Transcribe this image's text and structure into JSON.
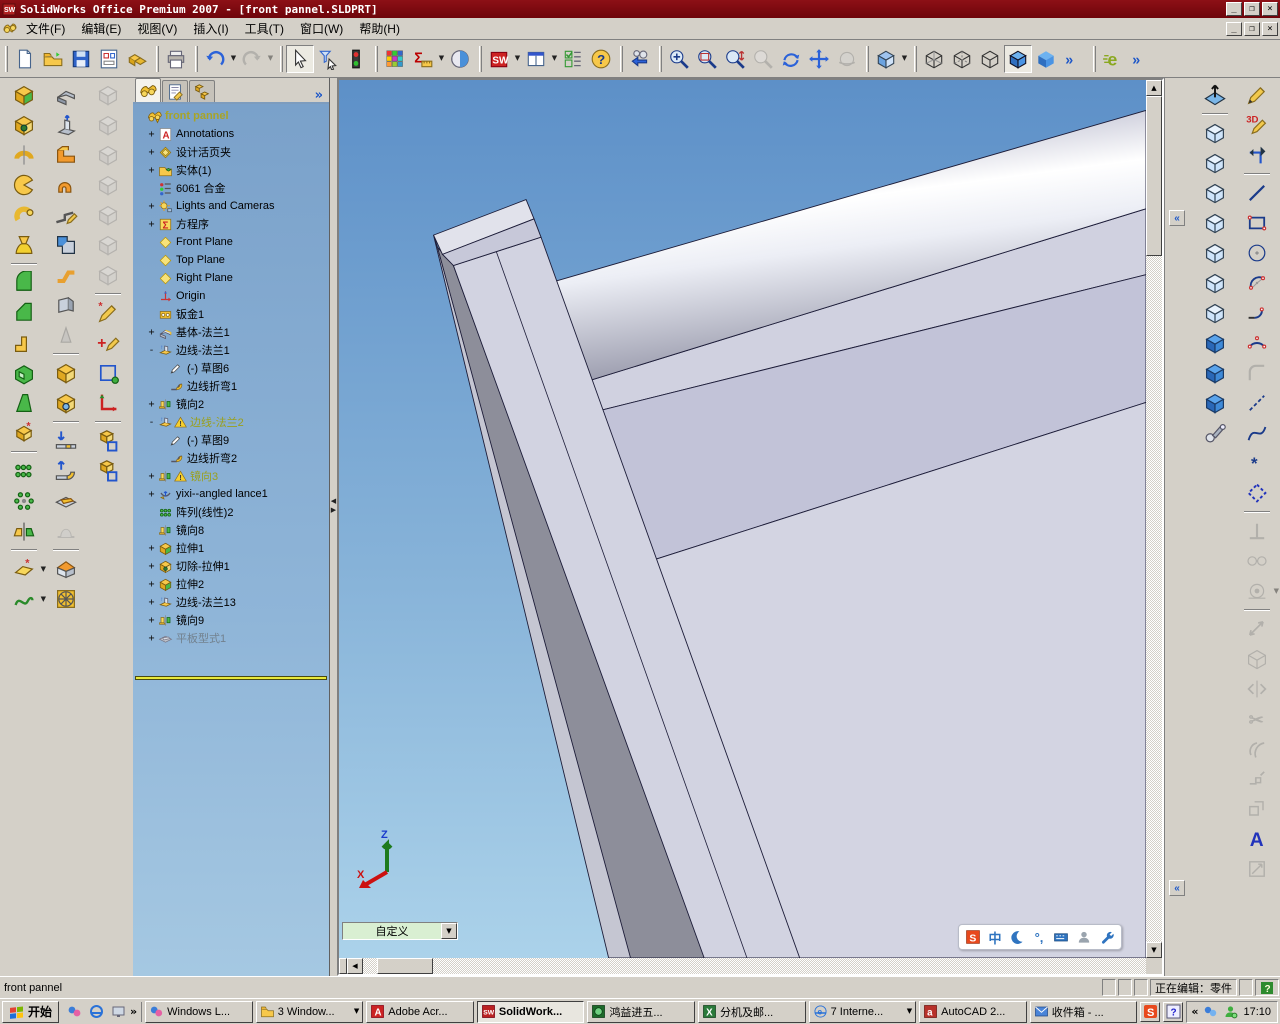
{
  "window": {
    "title": "SolidWorks Office Premium 2007 - [front pannel.SLDPRT]",
    "app_icon": "solidworks-logo",
    "controls": [
      "minimize",
      "restore",
      "close"
    ]
  },
  "menubar": {
    "doc_icon": "solidworks-doc",
    "items": [
      "文件(F)",
      "编辑(E)",
      "视图(V)",
      "插入(I)",
      "工具(T)",
      "窗口(W)",
      "帮助(H)"
    ]
  },
  "toolbar": {
    "groups": [
      [
        {
          "icon": "new-doc",
          "name": "new-document"
        },
        {
          "icon": "open-folder",
          "name": "open"
        },
        {
          "icon": "save",
          "name": "save"
        },
        {
          "icon": "make-drawing",
          "name": "make-drawing-from-part"
        },
        {
          "icon": "make-assembly",
          "name": "make-assembly-from-part"
        }
      ],
      [
        {
          "icon": "print",
          "name": "print"
        }
      ],
      [
        {
          "icon": "undo",
          "name": "undo",
          "dd": true
        },
        {
          "icon": "redo",
          "name": "redo",
          "dd": true,
          "dis": true
        }
      ],
      [
        {
          "icon": "select",
          "name": "select",
          "pressed": true
        },
        {
          "icon": "filter",
          "name": "selection-filter"
        },
        {
          "icon": "traffic",
          "name": "stoplight-rebuild"
        }
      ],
      [
        {
          "icon": "palette",
          "name": "color-swatches"
        },
        {
          "icon": "measure",
          "name": "measure",
          "dd": true
        },
        {
          "icon": "appearance",
          "name": "appearance"
        }
      ],
      [
        {
          "icon": "sw-central",
          "name": "3d-content-central",
          "dd": true
        },
        {
          "icon": "split-view",
          "name": "split-window",
          "dd": true
        },
        {
          "icon": "options-list",
          "name": "options"
        },
        {
          "icon": "help",
          "name": "help"
        }
      ],
      [
        {
          "icon": "view-prev",
          "name": "previous-view"
        }
      ],
      [
        {
          "icon": "zoom-fit",
          "name": "zoom-to-fit"
        },
        {
          "icon": "zoom-area",
          "name": "zoom-to-area"
        },
        {
          "icon": "zoom-inout",
          "name": "zoom-in-out"
        },
        {
          "icon": "zoom-select",
          "name": "zoom-to-selection",
          "dis": true
        },
        {
          "icon": "rotate-view",
          "name": "rotate-view"
        },
        {
          "icon": "pan",
          "name": "pan"
        },
        {
          "icon": "rotate-3d",
          "name": "rotate-about-axis",
          "dis": true
        }
      ],
      [
        {
          "icon": "std-views",
          "name": "standard-views",
          "dd": true
        }
      ],
      [
        {
          "icon": "cube-wire",
          "name": "wireframe"
        },
        {
          "icon": "cube-hlv",
          "name": "hidden-lines-visible"
        },
        {
          "icon": "cube-hlr",
          "name": "hidden-lines-removed"
        },
        {
          "icon": "cube-shaded-edges",
          "name": "shaded-with-edges",
          "pressed": true
        },
        {
          "icon": "cube-shaded",
          "name": "shaded"
        },
        {
          "icon": "chevrons",
          "name": "toolbar-overflow"
        }
      ],
      [
        {
          "icon": "edrawings",
          "name": "edrawings"
        },
        {
          "icon": "chevrons",
          "name": "toolbar-overflow-2"
        }
      ]
    ]
  },
  "left_dock": {
    "columns": [
      [
        {
          "icon": "extrude",
          "name": "extruded-boss"
        },
        {
          "icon": "cut-extrude",
          "name": "extruded-cut"
        },
        {
          "icon": "revolve",
          "name": "revolved-boss"
        },
        {
          "icon": "cut-revolve",
          "name": "revolved-cut"
        },
        {
          "icon": "sweep",
          "name": "swept-boss"
        },
        {
          "icon": "loft",
          "name": "lofted-boss"
        },
        "-",
        {
          "icon": "fillet",
          "name": "fillet"
        },
        {
          "icon": "chamfer",
          "name": "chamfer"
        },
        {
          "icon": "rib",
          "name": "rib"
        },
        {
          "icon": "shell",
          "name": "shell"
        },
        {
          "icon": "draft",
          "name": "draft"
        },
        {
          "icon": "hole-wizard",
          "name": "hole-wizard"
        },
        "-",
        {
          "icon": "lin-pattern",
          "name": "linear-pattern"
        },
        {
          "icon": "circ-pattern",
          "name": "circular-pattern"
        },
        {
          "icon": "mirror-feat",
          "name": "mirror-feature"
        },
        "-",
        {
          "icon": "ref-geom",
          "name": "reference-geometry",
          "dd": true
        },
        {
          "icon": "curves",
          "name": "curves",
          "dd": true
        }
      ],
      [
        {
          "icon": "base-flange",
          "name": "base-flange"
        },
        {
          "icon": "edge-flange",
          "name": "edge-flange"
        },
        {
          "icon": "miter-flange",
          "name": "miter-flange"
        },
        {
          "icon": "hem",
          "name": "hem"
        },
        {
          "icon": "sketched-bend",
          "name": "sketched-bend"
        },
        {
          "icon": "closed-corner",
          "name": "closed-corner"
        },
        {
          "icon": "jog",
          "name": "jog"
        },
        {
          "icon": "break-corner",
          "name": "break-corner"
        },
        {
          "icon": "rip",
          "name": "rip",
          "dis": true
        },
        "-",
        {
          "icon": "sm-cut",
          "name": "sheetmetal-cut"
        },
        {
          "icon": "sm-hole",
          "name": "simple-hole"
        },
        "-",
        {
          "icon": "unfold",
          "name": "unfold"
        },
        {
          "icon": "fold",
          "name": "fold"
        },
        {
          "icon": "flatten",
          "name": "flatten"
        },
        {
          "icon": "forming",
          "name": "forming-tool",
          "dis": true
        },
        "-",
        {
          "icon": "fold-metal",
          "name": "welded-corner"
        },
        {
          "icon": "vent",
          "name": "vent"
        }
      ],
      [
        {
          "icon": "graycube",
          "name": "view-cube-1",
          "dis": true
        },
        {
          "icon": "graycube",
          "name": "view-cube-2",
          "dis": true
        },
        {
          "icon": "graycube",
          "name": "view-cube-3",
          "dis": true
        },
        {
          "icon": "graycube",
          "name": "view-cube-4",
          "dis": true
        },
        {
          "icon": "graycube",
          "name": "view-cube-5",
          "dis": true
        },
        {
          "icon": "graycube",
          "name": "view-cube-6",
          "dis": true
        },
        {
          "icon": "graycube",
          "name": "view-cube-7",
          "dis": true
        },
        "-",
        {
          "icon": "sketch-star",
          "name": "sketch-tool"
        },
        {
          "icon": "modify-sketch",
          "name": "modify-sketch"
        },
        {
          "icon": "grid-square",
          "name": "grid-settings"
        },
        {
          "icon": "axes",
          "name": "coordinate-system"
        },
        "-",
        {
          "icon": "cube-frame",
          "name": "isolate-body-1"
        },
        {
          "icon": "cube-frame",
          "name": "isolate-body-2"
        }
      ]
    ]
  },
  "right_dock": {
    "columns": [
      [
        {
          "icon": "normal-to",
          "name": "normal-to"
        },
        "-",
        {
          "icon": "vcube",
          "name": "front-view"
        },
        {
          "icon": "vcube",
          "name": "back-view"
        },
        {
          "icon": "vcube",
          "name": "left-view"
        },
        {
          "icon": "vcube",
          "name": "right-view"
        },
        {
          "icon": "vcube",
          "name": "top-view"
        },
        {
          "icon": "vcube",
          "name": "bottom-view"
        },
        {
          "icon": "vcube",
          "name": "isometric-view"
        },
        {
          "icon": "scube",
          "name": "trimetric-view"
        },
        {
          "icon": "scube",
          "name": "dimetric-view"
        },
        {
          "icon": "scube",
          "name": "shaded-iso-view"
        },
        {
          "icon": "camera",
          "name": "camera-view"
        }
      ],
      [
        {
          "icon": "sketch",
          "name": "sketch"
        },
        {
          "icon": "sketch3d",
          "name": "3d-sketch"
        },
        {
          "icon": "rotate-sketch",
          "name": "modify-sketch-rotate"
        },
        "-",
        {
          "icon": "line",
          "name": "line"
        },
        {
          "icon": "rectangle",
          "name": "rectangle"
        },
        {
          "icon": "circle",
          "name": "circle"
        },
        {
          "icon": "cp-arc",
          "name": "centerpoint-arc"
        },
        {
          "icon": "tan-arc",
          "name": "tangent-arc"
        },
        {
          "icon": "arc3pt",
          "name": "3-point-arc"
        },
        {
          "icon": "fillet-sk",
          "name": "sketch-fillet",
          "dis": true
        },
        {
          "icon": "centerline",
          "name": "centerline"
        },
        {
          "icon": "spline",
          "name": "spline"
        },
        {
          "icon": "point",
          "name": "point"
        },
        {
          "icon": "sel-dash",
          "name": "select-partial"
        },
        "-",
        {
          "icon": "perp",
          "name": "perpendicular-relation",
          "dis": true
        },
        {
          "icon": "relations",
          "name": "add-relation",
          "dis": true
        },
        {
          "icon": "rel-dd",
          "name": "display-relations",
          "dis": true,
          "dd": true
        },
        "-",
        {
          "icon": "dim",
          "name": "smart-dimension",
          "dis": true
        },
        {
          "icon": "cube-o",
          "name": "convert-entities",
          "dis": true
        },
        {
          "icon": "mirror-sk",
          "name": "mirror-entities",
          "dis": true
        },
        {
          "icon": "trim",
          "name": "trim-entities",
          "dis": true
        },
        {
          "icon": "offset",
          "name": "offset-entities",
          "dis": true
        },
        {
          "icon": "move-sk",
          "name": "move-entities",
          "dis": true
        },
        {
          "icon": "copy-sk",
          "name": "copy-entities",
          "dis": true
        },
        {
          "icon": "text-A",
          "name": "sketch-text"
        },
        {
          "icon": "modify-grid",
          "name": "modify-sketch-grid",
          "dis": true
        }
      ]
    ]
  },
  "tree": {
    "tabs": [
      {
        "icon": "tab-fm",
        "name": "featuremanager-tab",
        "active": true
      },
      {
        "icon": "tab-pm",
        "name": "propertymanager-tab",
        "active": false
      },
      {
        "icon": "tab-cm",
        "name": "configurationmanager-tab",
        "active": false
      }
    ],
    "overflow": "»",
    "items": [
      {
        "l": "front pannel",
        "ic": "t-part",
        "ex": "",
        "st": "root",
        "d": 0
      },
      {
        "l": "Annotations",
        "ic": "t-ann",
        "ex": "+",
        "d": 1
      },
      {
        "l": "设计活页夹",
        "ic": "t-binder",
        "ex": "+",
        "d": 1
      },
      {
        "l": "实体(1)",
        "ic": "t-solids",
        "ex": "+",
        "d": 1
      },
      {
        "l": "6061 合金",
        "ic": "t-material",
        "ex": "",
        "d": 1
      },
      {
        "l": "Lights and Cameras",
        "ic": "t-lights",
        "ex": "+",
        "d": 1
      },
      {
        "l": "方程序",
        "ic": "t-eq",
        "ex": "+",
        "d": 1
      },
      {
        "l": "Front Plane",
        "ic": "t-plane",
        "ex": "",
        "d": 1
      },
      {
        "l": "Top Plane",
        "ic": "t-plane",
        "ex": "",
        "d": 1
      },
      {
        "l": "Right Plane",
        "ic": "t-plane",
        "ex": "",
        "d": 1
      },
      {
        "l": "Origin",
        "ic": "t-origin",
        "ex": "",
        "d": 1
      },
      {
        "l": "钣金1",
        "ic": "t-sm",
        "ex": "",
        "d": 1
      },
      {
        "l": "基体-法兰1",
        "ic": "t-baseflange",
        "ex": "+",
        "d": 1
      },
      {
        "l": "边线-法兰1",
        "ic": "t-edgeflange",
        "ex": "-",
        "d": 1
      },
      {
        "l": "(-) 草图6",
        "ic": "t-sketch",
        "ex": "",
        "d": 2
      },
      {
        "l": "边线折弯1",
        "ic": "t-bend",
        "ex": "",
        "d": 2
      },
      {
        "l": "镜向2",
        "ic": "t-mirror",
        "ex": "+",
        "d": 1
      },
      {
        "l": "边线-法兰2",
        "ic": "t-edgeflange",
        "ex": "-",
        "st": "warning",
        "w": true,
        "d": 1
      },
      {
        "l": "(-) 草图9",
        "ic": "t-sketch",
        "ex": "",
        "d": 2
      },
      {
        "l": "边线折弯2",
        "ic": "t-bend",
        "ex": "",
        "d": 2
      },
      {
        "l": "镜向3",
        "ic": "t-mirror",
        "ex": "+",
        "st": "warning",
        "w": true,
        "d": 1
      },
      {
        "l": "yixi--angled lance1",
        "ic": "t-lance",
        "ex": "+",
        "d": 1
      },
      {
        "l": "阵列(线性)2",
        "ic": "t-pattern",
        "ex": "",
        "d": 1
      },
      {
        "l": "镜向8",
        "ic": "t-mirror",
        "ex": "",
        "d": 1
      },
      {
        "l": "拉伸1",
        "ic": "t-extrude",
        "ex": "+",
        "d": 1
      },
      {
        "l": "切除-拉伸1",
        "ic": "t-cut",
        "ex": "+",
        "d": 1
      },
      {
        "l": "拉伸2",
        "ic": "t-extrude",
        "ex": "+",
        "d": 1
      },
      {
        "l": "边线-法兰13",
        "ic": "t-edgeflange",
        "ex": "+",
        "d": 1
      },
      {
        "l": "镜向9",
        "ic": "t-mirror",
        "ex": "+",
        "d": 1
      },
      {
        "l": "平板型式1",
        "ic": "t-flat",
        "ex": "+",
        "st": "suppressed",
        "d": 1
      }
    ]
  },
  "viewport": {
    "combo": {
      "value": "自定义"
    },
    "triad": {
      "x_label": "X",
      "z_label": "Z"
    },
    "ime_bar": {
      "items": [
        {
          "icon": "ime-sogou",
          "name": "sogou-logo"
        },
        {
          "text": "中",
          "name": "chinese-english-toggle"
        },
        {
          "icon": "ime-moon",
          "name": "full-half-width-toggle"
        },
        {
          "text": "°,",
          "name": "punctuation-toggle"
        },
        {
          "icon": "ime-kbd",
          "name": "soft-keyboard"
        },
        {
          "icon": "ime-user",
          "name": "user-account"
        },
        {
          "icon": "ime-wrench",
          "name": "ime-settings"
        }
      ]
    }
  },
  "statusbar": {
    "left": "front pannel",
    "edit_state": "正在编辑：零件",
    "help_icon": "question-mark"
  },
  "taskbar": {
    "start": "开始",
    "quick_launch_more": "»",
    "tasks": [
      {
        "label": "Windows L...",
        "icon": "tb-msn"
      },
      {
        "label": "3 Window...",
        "icon": "tb-folder",
        "dd": true
      },
      {
        "label": "Adobe Acr...",
        "icon": "tb-acrobat"
      },
      {
        "label": "SolidWork...",
        "icon": "tb-sw",
        "active": true
      },
      {
        "label": "鸿益进五...",
        "icon": "tb-green"
      },
      {
        "label": "分机及邮...",
        "icon": "tb-excel"
      },
      {
        "label": "7 Interne...",
        "icon": "tb-ie",
        "dd": true
      },
      {
        "label": "AutoCAD 2...",
        "icon": "tb-acad"
      },
      {
        "label": "收件箱 - ...",
        "icon": "tb-outlook"
      }
    ],
    "tray": {
      "chevron": "«",
      "time": "17:10"
    }
  },
  "colors": {
    "titlebar": "#7c0b10",
    "ui_gray": "#d4d0c8",
    "viewport_top": "#5d90c8",
    "viewport_bottom": "#abd2ea",
    "rollback_yellow": "#e8e93c",
    "accent_blue": "#2b62d9",
    "model_face": "#d3d4e2",
    "model_band": "#c2c3d8",
    "model_dark": "#8d8e9a"
  }
}
